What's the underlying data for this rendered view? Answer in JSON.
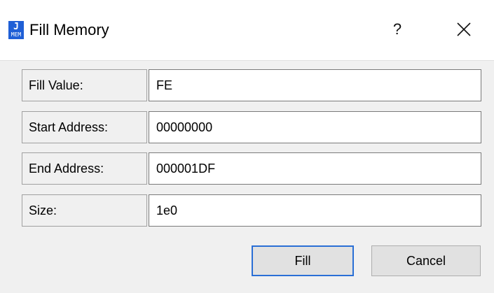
{
  "window": {
    "title": "Fill Memory",
    "icon": "jmem-app-icon",
    "icon_text_top": "J",
    "icon_text_bottom": "MEM",
    "help_label": "?",
    "accent_color": "#2a6fd6"
  },
  "fields": [
    {
      "label": "Fill Value:",
      "value": "FE"
    },
    {
      "label": "Start Address:",
      "value": "00000000"
    },
    {
      "label": "End Address:",
      "value": "000001DF"
    },
    {
      "label": "Size:",
      "value": "1e0"
    }
  ],
  "buttons": {
    "fill_label": "Fill",
    "cancel_label": "Cancel"
  }
}
